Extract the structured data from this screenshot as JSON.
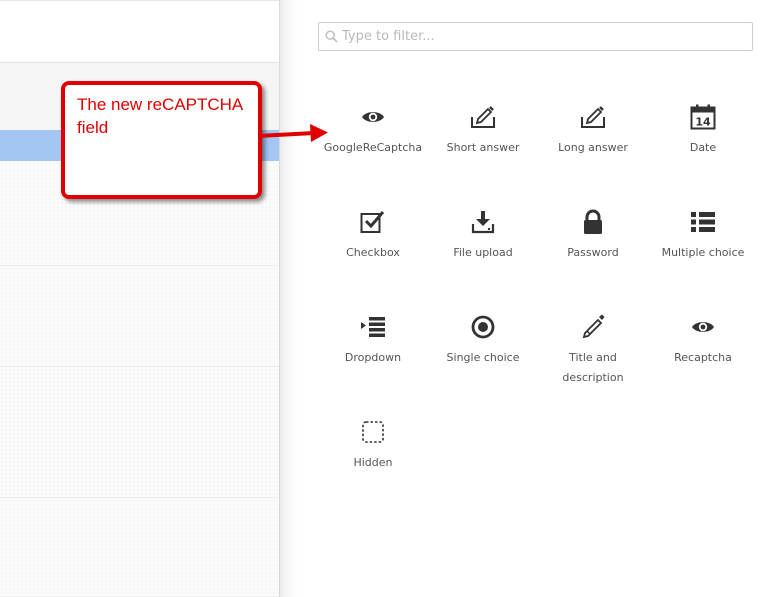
{
  "filter": {
    "placeholder": "Type to filter..."
  },
  "callout": {
    "text": "The new reCAPTCHA field"
  },
  "fields": [
    {
      "label": "GoogleReCaptcha",
      "icon": "eye-icon"
    },
    {
      "label": "Short answer",
      "icon": "edit-icon"
    },
    {
      "label": "Long answer",
      "icon": "edit-icon"
    },
    {
      "label": "Date",
      "icon": "calendar-icon",
      "icon_text": "14"
    },
    {
      "label": "Checkbox",
      "icon": "checkbox-icon"
    },
    {
      "label": "File upload",
      "icon": "download-icon"
    },
    {
      "label": "Password",
      "icon": "lock-icon"
    },
    {
      "label": "Multiple choice",
      "icon": "list-icon"
    },
    {
      "label": "Dropdown",
      "icon": "indent-list-icon"
    },
    {
      "label": "Single choice",
      "icon": "radio-icon"
    },
    {
      "label": "Title and description",
      "icon": "pencil-icon"
    },
    {
      "label": "Recaptcha",
      "icon": "eye-icon"
    },
    {
      "label": "Hidden",
      "icon": "dashed-square-icon"
    }
  ]
}
